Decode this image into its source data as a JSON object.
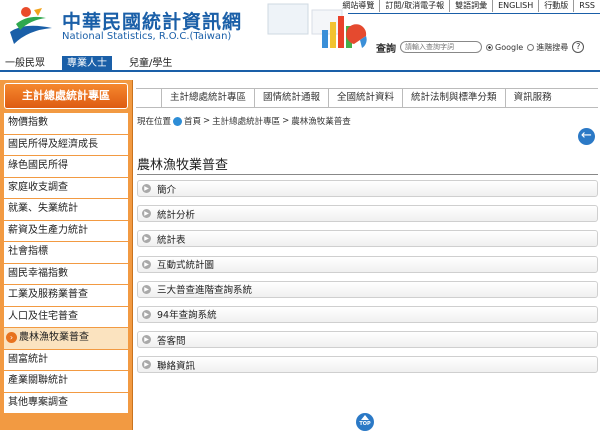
{
  "header": {
    "title": "中華民國統計資訊網",
    "subtitle": "National Statistics, R.O.C.(Taiwan)",
    "top_links": [
      "網站導覽",
      "訂閱/取消電子報",
      "雙語詞彙",
      "ENGLISH",
      "行動版",
      "RSS"
    ],
    "search": {
      "label": "查詢",
      "placeholder": "請輸入查詢字詞",
      "options": [
        "Google",
        "進階搜尋"
      ],
      "selected": "Google"
    }
  },
  "audience_tabs": [
    {
      "label": "一般民眾",
      "active": false
    },
    {
      "label": "專業人士",
      "active": true
    },
    {
      "label": "兒童/學生",
      "active": false
    }
  ],
  "sidebar": {
    "heading": "主計總處統計專區",
    "items": [
      {
        "label": "物價指數",
        "active": false
      },
      {
        "label": "國民所得及經濟成長",
        "active": false
      },
      {
        "label": "綠色國民所得",
        "active": false
      },
      {
        "label": "家庭收支調查",
        "active": false
      },
      {
        "label": "就業、失業統計",
        "active": false
      },
      {
        "label": "薪資及生產力統計",
        "active": false
      },
      {
        "label": "社會指標",
        "active": false
      },
      {
        "label": "國民幸福指數",
        "active": false
      },
      {
        "label": "工業及服務業普查",
        "active": false
      },
      {
        "label": "人口及住宅普查",
        "active": false
      },
      {
        "label": "農林漁牧業普查",
        "active": true
      },
      {
        "label": "國富統計",
        "active": false
      },
      {
        "label": "產業關聯統計",
        "active": false
      },
      {
        "label": "其他專案調查",
        "active": false
      }
    ]
  },
  "nav": {
    "items": [
      "主計總處統計專區",
      "國情統計通報",
      "全國統計資料",
      "統計法制與標準分類",
      "資訊服務"
    ]
  },
  "breadcrumb": {
    "prefix": "現在位置",
    "items": [
      "首頁",
      "主計總處統計專區",
      "農林漁牧業普查"
    ]
  },
  "main": {
    "title": "農林漁牧業普查",
    "sections": [
      "簡介",
      "統計分析",
      "統計表",
      "互動式統計圖",
      "三大普查進階查詢系統",
      "94年查詢系統",
      "答客問",
      "聯絡資訊"
    ]
  },
  "footer": {
    "top_label": "TOP"
  },
  "colors": {
    "brand_blue": "#1a5fa8",
    "sidebar_orange": "#f29a42",
    "sidebar_head": "#de5b12"
  }
}
